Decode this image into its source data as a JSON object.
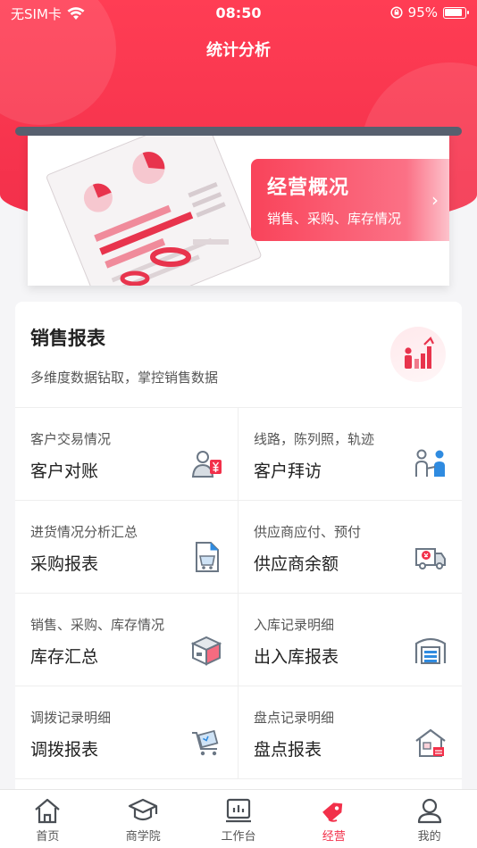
{
  "status_bar": {
    "carrier": "无SIM卡",
    "time": "08:50",
    "battery": "95%"
  },
  "page_title": "统计分析",
  "banner": {
    "title": "经营概况",
    "subtitle": "销售、采购、库存情况"
  },
  "report": {
    "title": "销售报表",
    "subtitle": "多维度数据钻取，掌控销售数据",
    "rows": [
      [
        {
          "sub": "客户交易情况",
          "main": "客户对账",
          "icon": "customer-yen-icon"
        },
        {
          "sub": "线路，陈列照，轨迹",
          "main": "客户拜访",
          "icon": "visit-people-icon"
        }
      ],
      [
        {
          "sub": "进货情况分析汇总",
          "main": "采购报表",
          "icon": "purchase-doc-icon"
        },
        {
          "sub": "供应商应付、预付",
          "main": "供应商余额",
          "icon": "supplier-truck-icon"
        }
      ],
      [
        {
          "sub": "销售、采购、库存情况",
          "main": "库存汇总",
          "icon": "stock-box-icon"
        },
        {
          "sub": "入库记录明细",
          "main": "出入库报表",
          "icon": "warehouse-icon"
        }
      ],
      [
        {
          "sub": "调拨记录明细",
          "main": "调拨报表",
          "icon": "transfer-cart-icon"
        },
        {
          "sub": "盘点记录明细",
          "main": "盘点报表",
          "icon": "inventory-house-icon"
        }
      ]
    ]
  },
  "tabbar": {
    "items": [
      {
        "label": "首页",
        "icon": "home-icon"
      },
      {
        "label": "商学院",
        "icon": "graduation-cap-icon"
      },
      {
        "label": "工作台",
        "icon": "workbench-icon"
      },
      {
        "label": "经营",
        "icon": "price-tag-icon"
      },
      {
        "label": "我的",
        "icon": "user-icon"
      }
    ],
    "active_index": 3
  },
  "colors": {
    "brand_red": "#f2304a",
    "text_dark": "#222222",
    "text_sub": "#555555"
  }
}
